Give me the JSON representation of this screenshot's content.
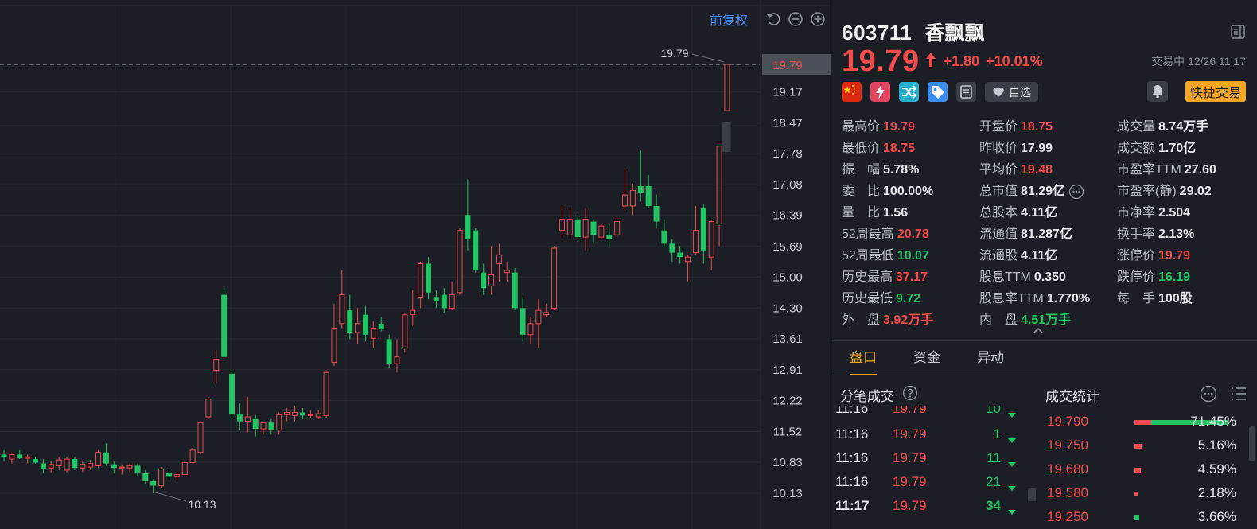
{
  "chart": {
    "toolbar": {
      "adjust_label": "前复权"
    },
    "y_ticks": [
      "19.79",
      "19.17",
      "18.47",
      "17.78",
      "17.08",
      "16.39",
      "15.69",
      "15.00",
      "14.30",
      "13.61",
      "12.91",
      "12.22",
      "11.52",
      "10.83",
      "10.13"
    ],
    "current_price_tag": "19.79",
    "max_label": "19.79",
    "min_label": "10.13",
    "colors": {
      "up": "#f24b4b",
      "down": "#23c464",
      "grid": "#262a31",
      "axis_text": "#c9ccd2"
    }
  },
  "chart_data": {
    "type": "candlestick",
    "ylim": [
      9.6,
      20.2
    ],
    "candles": [
      {
        "o": 11.0,
        "h": 11.1,
        "l": 10.85,
        "c": 10.95
      },
      {
        "o": 10.9,
        "h": 11.05,
        "l": 10.8,
        "c": 11.0
      },
      {
        "o": 11.0,
        "h": 11.1,
        "l": 10.9,
        "c": 10.92
      },
      {
        "o": 10.92,
        "h": 11.0,
        "l": 10.8,
        "c": 10.95
      },
      {
        "o": 10.9,
        "h": 10.95,
        "l": 10.8,
        "c": 10.82
      },
      {
        "o": 10.8,
        "h": 10.9,
        "l": 10.58,
        "c": 10.68
      },
      {
        "o": 10.7,
        "h": 10.85,
        "l": 10.6,
        "c": 10.78
      },
      {
        "o": 10.75,
        "h": 10.95,
        "l": 10.65,
        "c": 10.88
      },
      {
        "o": 10.65,
        "h": 10.95,
        "l": 10.6,
        "c": 10.9
      },
      {
        "o": 10.9,
        "h": 10.95,
        "l": 10.65,
        "c": 10.7
      },
      {
        "o": 10.7,
        "h": 10.85,
        "l": 10.62,
        "c": 10.78
      },
      {
        "o": 10.72,
        "h": 10.88,
        "l": 10.65,
        "c": 10.8
      },
      {
        "o": 10.75,
        "h": 11.1,
        "l": 10.7,
        "c": 11.05
      },
      {
        "o": 11.05,
        "h": 11.25,
        "l": 10.75,
        "c": 10.8
      },
      {
        "o": 10.78,
        "h": 10.85,
        "l": 10.58,
        "c": 10.7
      },
      {
        "o": 10.7,
        "h": 10.78,
        "l": 10.55,
        "c": 10.72
      },
      {
        "o": 10.7,
        "h": 10.8,
        "l": 10.6,
        "c": 10.75
      },
      {
        "o": 10.75,
        "h": 10.8,
        "l": 10.52,
        "c": 10.6
      },
      {
        "o": 10.58,
        "h": 10.65,
        "l": 10.35,
        "c": 10.4
      },
      {
        "o": 10.4,
        "h": 10.45,
        "l": 10.13,
        "c": 10.3
      },
      {
        "o": 10.3,
        "h": 10.72,
        "l": 10.25,
        "c": 10.68
      },
      {
        "o": 10.58,
        "h": 10.65,
        "l": 10.45,
        "c": 10.5
      },
      {
        "o": 10.5,
        "h": 10.62,
        "l": 10.42,
        "c": 10.55
      },
      {
        "o": 10.55,
        "h": 10.85,
        "l": 10.5,
        "c": 10.82
      },
      {
        "o": 10.82,
        "h": 11.15,
        "l": 10.8,
        "c": 11.1
      },
      {
        "o": 11.05,
        "h": 11.75,
        "l": 11.0,
        "c": 11.72
      },
      {
        "o": 11.85,
        "h": 12.3,
        "l": 11.8,
        "c": 12.25
      },
      {
        "o": 12.9,
        "h": 13.35,
        "l": 12.6,
        "c": 13.15
      },
      {
        "o": 14.6,
        "h": 14.75,
        "l": 13.2,
        "c": 13.2
      },
      {
        "o": 12.82,
        "h": 12.9,
        "l": 11.85,
        "c": 11.9
      },
      {
        "o": 11.9,
        "h": 12.15,
        "l": 11.55,
        "c": 11.75
      },
      {
        "o": 11.75,
        "h": 12.3,
        "l": 11.5,
        "c": 11.85
      },
      {
        "o": 11.8,
        "h": 11.9,
        "l": 11.4,
        "c": 11.58
      },
      {
        "o": 11.58,
        "h": 11.7,
        "l": 11.45,
        "c": 11.72
      },
      {
        "o": 11.72,
        "h": 11.8,
        "l": 11.45,
        "c": 11.55
      },
      {
        "o": 11.55,
        "h": 11.95,
        "l": 11.45,
        "c": 11.9
      },
      {
        "o": 11.9,
        "h": 12.05,
        "l": 11.75,
        "c": 11.95
      },
      {
        "o": 11.88,
        "h": 12.1,
        "l": 11.75,
        "c": 11.95
      },
      {
        "o": 11.95,
        "h": 12.05,
        "l": 11.8,
        "c": 11.88
      },
      {
        "o": 11.88,
        "h": 12.0,
        "l": 11.82,
        "c": 11.9
      },
      {
        "o": 11.85,
        "h": 12.0,
        "l": 11.8,
        "c": 11.92
      },
      {
        "o": 11.88,
        "h": 12.9,
        "l": 11.82,
        "c": 12.85
      },
      {
        "o": 13.08,
        "h": 14.4,
        "l": 13.0,
        "c": 13.85
      },
      {
        "o": 13.95,
        "h": 15.15,
        "l": 13.85,
        "c": 14.6
      },
      {
        "o": 14.25,
        "h": 14.6,
        "l": 13.6,
        "c": 13.75
      },
      {
        "o": 13.75,
        "h": 14.3,
        "l": 13.5,
        "c": 13.95
      },
      {
        "o": 14.15,
        "h": 14.35,
        "l": 13.55,
        "c": 13.7
      },
      {
        "o": 13.62,
        "h": 14.0,
        "l": 13.4,
        "c": 13.85
      },
      {
        "o": 13.95,
        "h": 14.1,
        "l": 13.78,
        "c": 13.82
      },
      {
        "o": 13.6,
        "h": 13.7,
        "l": 12.95,
        "c": 13.05
      },
      {
        "o": 13.05,
        "h": 13.6,
        "l": 12.85,
        "c": 13.2
      },
      {
        "o": 13.4,
        "h": 14.2,
        "l": 13.3,
        "c": 14.15
      },
      {
        "o": 14.15,
        "h": 14.7,
        "l": 13.9,
        "c": 14.25
      },
      {
        "o": 14.55,
        "h": 15.35,
        "l": 14.3,
        "c": 15.3
      },
      {
        "o": 15.3,
        "h": 15.45,
        "l": 14.5,
        "c": 14.65
      },
      {
        "o": 14.55,
        "h": 14.7,
        "l": 14.3,
        "c": 14.45
      },
      {
        "o": 14.6,
        "h": 14.75,
        "l": 14.2,
        "c": 14.3
      },
      {
        "o": 14.3,
        "h": 14.9,
        "l": 14.25,
        "c": 14.6
      },
      {
        "o": 14.65,
        "h": 16.1,
        "l": 14.6,
        "c": 16.05
      },
      {
        "o": 16.4,
        "h": 17.2,
        "l": 15.6,
        "c": 15.85
      },
      {
        "o": 16.05,
        "h": 16.1,
        "l": 15.1,
        "c": 15.15
      },
      {
        "o": 15.1,
        "h": 15.3,
        "l": 14.6,
        "c": 14.75
      },
      {
        "o": 14.8,
        "h": 15.7,
        "l": 14.6,
        "c": 15.05
      },
      {
        "o": 15.3,
        "h": 15.75,
        "l": 14.9,
        "c": 15.5
      },
      {
        "o": 15.1,
        "h": 15.35,
        "l": 14.9,
        "c": 15.15
      },
      {
        "o": 15.1,
        "h": 15.2,
        "l": 14.25,
        "c": 14.3
      },
      {
        "o": 14.3,
        "h": 14.55,
        "l": 13.55,
        "c": 13.7
      },
      {
        "o": 13.7,
        "h": 14.1,
        "l": 13.5,
        "c": 13.95
      },
      {
        "o": 13.95,
        "h": 14.5,
        "l": 13.4,
        "c": 14.25
      },
      {
        "o": 14.15,
        "h": 14.4,
        "l": 14.1,
        "c": 14.2
      },
      {
        "o": 14.3,
        "h": 15.7,
        "l": 14.25,
        "c": 15.65
      },
      {
        "o": 16.05,
        "h": 16.6,
        "l": 15.9,
        "c": 16.3
      },
      {
        "o": 15.95,
        "h": 16.55,
        "l": 15.9,
        "c": 16.3
      },
      {
        "o": 16.3,
        "h": 16.4,
        "l": 15.85,
        "c": 15.9
      },
      {
        "o": 15.9,
        "h": 16.55,
        "l": 15.6,
        "c": 16.3
      },
      {
        "o": 16.25,
        "h": 16.3,
        "l": 15.75,
        "c": 15.95
      },
      {
        "o": 15.9,
        "h": 16.2,
        "l": 15.85,
        "c": 16.15
      },
      {
        "o": 15.95,
        "h": 16.2,
        "l": 15.7,
        "c": 15.85
      },
      {
        "o": 15.95,
        "h": 16.35,
        "l": 15.9,
        "c": 16.25
      },
      {
        "o": 16.6,
        "h": 17.45,
        "l": 16.5,
        "c": 16.85
      },
      {
        "o": 16.6,
        "h": 17.1,
        "l": 16.4,
        "c": 16.95
      },
      {
        "o": 17.05,
        "h": 17.85,
        "l": 16.7,
        "c": 16.9
      },
      {
        "o": 17.05,
        "h": 17.3,
        "l": 16.55,
        "c": 16.6
      },
      {
        "o": 16.6,
        "h": 16.85,
        "l": 16.1,
        "c": 16.25
      },
      {
        "o": 16.05,
        "h": 16.3,
        "l": 15.7,
        "c": 15.75
      },
      {
        "o": 15.75,
        "h": 15.85,
        "l": 15.35,
        "c": 15.55
      },
      {
        "o": 15.55,
        "h": 15.7,
        "l": 15.3,
        "c": 15.45
      },
      {
        "o": 15.35,
        "h": 15.5,
        "l": 14.9,
        "c": 15.45
      },
      {
        "o": 15.55,
        "h": 16.6,
        "l": 15.5,
        "c": 16.05
      },
      {
        "o": 16.55,
        "h": 16.65,
        "l": 15.3,
        "c": 15.6
      },
      {
        "o": 15.45,
        "h": 16.3,
        "l": 15.15,
        "c": 16.25
      },
      {
        "o": 16.2,
        "h": 17.95,
        "l": 15.7,
        "c": 17.95
      },
      {
        "o": 18.75,
        "h": 19.79,
        "l": 18.75,
        "c": 19.79
      }
    ]
  },
  "header": {
    "code": "603711",
    "name": "香飘飘",
    "price": "19.79",
    "change": "+1.80",
    "change_pct": "+10.01%",
    "status": "交易中 12/26 11:17",
    "badge_cn": "",
    "zixuan_label": "自选",
    "quick_trade_label": "快捷交易"
  },
  "stats": {
    "col1": [
      {
        "k": "最高价",
        "v": "19.79",
        "c": "red"
      },
      {
        "k": "最低价",
        "v": "18.75",
        "c": "red"
      },
      {
        "k": "振　幅",
        "v": "5.78%",
        "c": "white"
      },
      {
        "k": "委　比",
        "v": "100.00%",
        "c": "white"
      },
      {
        "k": "量　比",
        "v": "1.56",
        "c": "white"
      },
      {
        "k": "52周最高",
        "v": "20.78",
        "c": "red"
      },
      {
        "k": "52周最低",
        "v": "10.07",
        "c": "green"
      },
      {
        "k": "历史最高",
        "v": "37.17",
        "c": "red"
      },
      {
        "k": "历史最低",
        "v": "9.72",
        "c": "green"
      },
      {
        "k": "外　盘",
        "v": "3.92万手",
        "c": "red"
      }
    ],
    "col2": [
      {
        "k": "开盘价",
        "v": "18.75",
        "c": "red"
      },
      {
        "k": "昨收价",
        "v": "17.99",
        "c": "white"
      },
      {
        "k": "平均价",
        "v": "19.48",
        "c": "red"
      },
      {
        "k": "总市值",
        "v": "81.29亿",
        "c": "white"
      },
      {
        "k": "总股本",
        "v": "4.11亿",
        "c": "white"
      },
      {
        "k": "流通值",
        "v": "81.287亿",
        "c": "white"
      },
      {
        "k": "流通股",
        "v": "4.11亿",
        "c": "white"
      },
      {
        "k": "股息TTM",
        "v": "0.350",
        "c": "white"
      },
      {
        "k": "股息率TTM",
        "v": "1.770%",
        "c": "white"
      },
      {
        "k": "内　盘",
        "v": "4.51万手",
        "c": "green"
      }
    ],
    "col3": [
      {
        "k": "成交量",
        "v": "8.74万手",
        "c": "white"
      },
      {
        "k": "成交额",
        "v": "1.70亿",
        "c": "white"
      },
      {
        "k": "市盈率TTM",
        "v": "27.60",
        "c": "white"
      },
      {
        "k": "市盈率(静)",
        "v": "29.02",
        "c": "white"
      },
      {
        "k": "市净率",
        "v": "2.504",
        "c": "white"
      },
      {
        "k": "换手率",
        "v": "2.13%",
        "c": "white"
      },
      {
        "k": "涨停价",
        "v": "19.79",
        "c": "red"
      },
      {
        "k": "跌停价",
        "v": "16.19",
        "c": "green"
      },
      {
        "k": "每　手",
        "v": "100股",
        "c": "white"
      }
    ]
  },
  "tabs": [
    {
      "label": "盘口",
      "active": true
    },
    {
      "label": "资金",
      "active": false
    },
    {
      "label": "异动",
      "active": false
    }
  ],
  "ticks": {
    "title": "分笔成交",
    "rows": [
      {
        "time": "11:16",
        "price": "19.79",
        "vol": "10",
        "bold": false
      },
      {
        "time": "11:16",
        "price": "19.79",
        "vol": "1",
        "bold": false
      },
      {
        "time": "11:16",
        "price": "19.79",
        "vol": "11",
        "bold": false
      },
      {
        "time": "11:16",
        "price": "19.79",
        "vol": "21",
        "bold": false
      },
      {
        "time": "11:17",
        "price": "19.79",
        "vol": "34",
        "bold": true
      }
    ]
  },
  "trade_stats": {
    "title": "成交统计",
    "rows": [
      {
        "price": "19.790",
        "pct": "71.45%",
        "buy_frac": 0.18,
        "sell_frac": 0.82,
        "share": 0.7145
      },
      {
        "price": "19.750",
        "pct": "5.16%",
        "buy_frac": 1.0,
        "sell_frac": 0.0,
        "share": 0.0516
      },
      {
        "price": "19.680",
        "pct": "4.59%",
        "buy_frac": 1.0,
        "sell_frac": 0.0,
        "share": 0.0459
      },
      {
        "price": "19.580",
        "pct": "2.18%",
        "buy_frac": 1.0,
        "sell_frac": 0.0,
        "share": 0.0218
      },
      {
        "price": "19.250",
        "pct": "3.66%",
        "buy_frac": 0.0,
        "sell_frac": 1.0,
        "share": 0.0366
      }
    ]
  }
}
